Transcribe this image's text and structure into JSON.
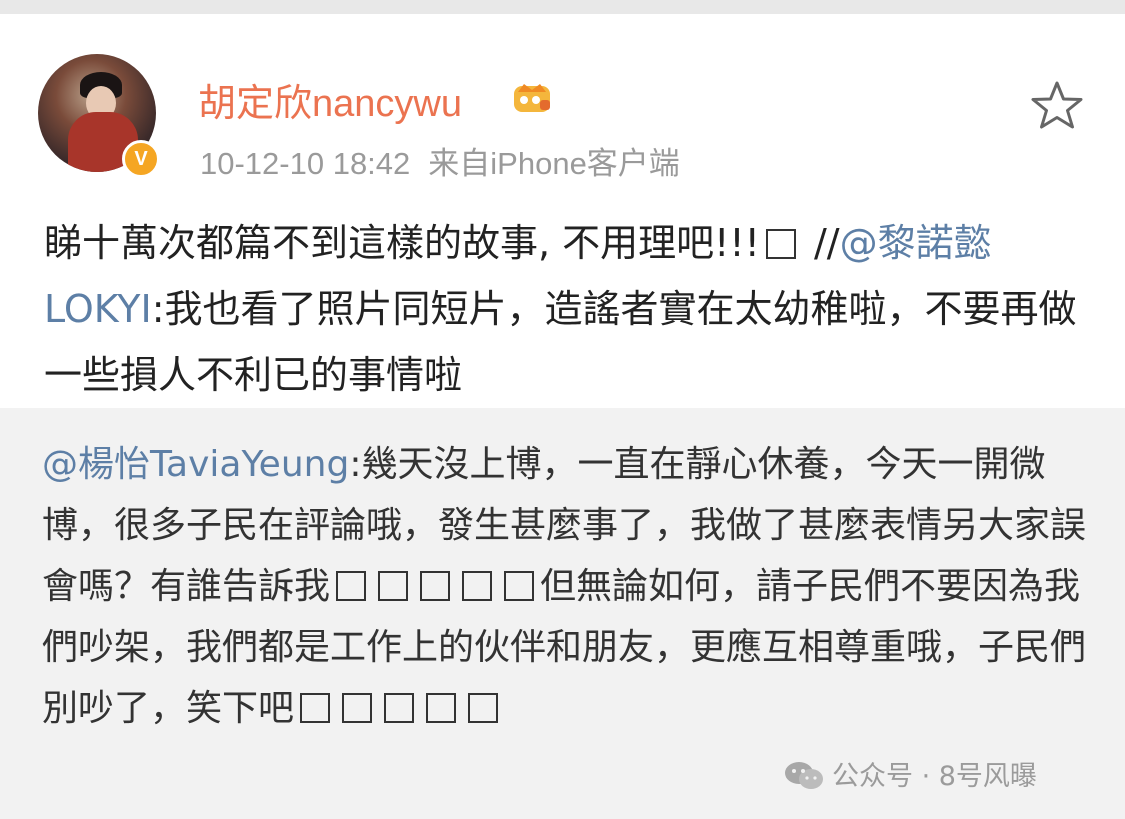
{
  "post": {
    "username": "胡定欣nancywu",
    "timestamp": "10-12-10 18:42",
    "source": "来自iPhone客户端",
    "badge_icon": "crown-icon",
    "verified_icon": "verified-v-icon",
    "verified_label": "V",
    "favorite_icon": "star-icon",
    "text_main": "睇十萬次都篇不到這樣的故事, 不用理吧!!!",
    "text_repost_prefix": "//",
    "mention": "@黎諾懿LOKYI",
    "text_quote": ":我也看了照片同短片，造謠者實在太幼稚啦，不要再做一些損人不利已的事情啦"
  },
  "repost": {
    "mention": "@楊怡TaviaYeung",
    "text_part1": ":幾天沒上博，一直在靜心休養，今天一開微博，很多子民在評論哦，發生甚麼事了，我做了甚麼表情另大家誤會嗎？有誰告訴我",
    "text_part2": "但無論如何，請子民們不要因為我們吵架，我們都是工作上的伙伴和朋友，更應互相尊重哦，子民們別吵了，笑下吧"
  },
  "watermark": {
    "icon": "wechat-icon",
    "text": "公众号 · 8号风曝"
  },
  "colors": {
    "username": "#eb7350",
    "mention": "#5d7fa6",
    "meta": "#9a9a9a",
    "repost_bg": "#f2f2f2"
  }
}
